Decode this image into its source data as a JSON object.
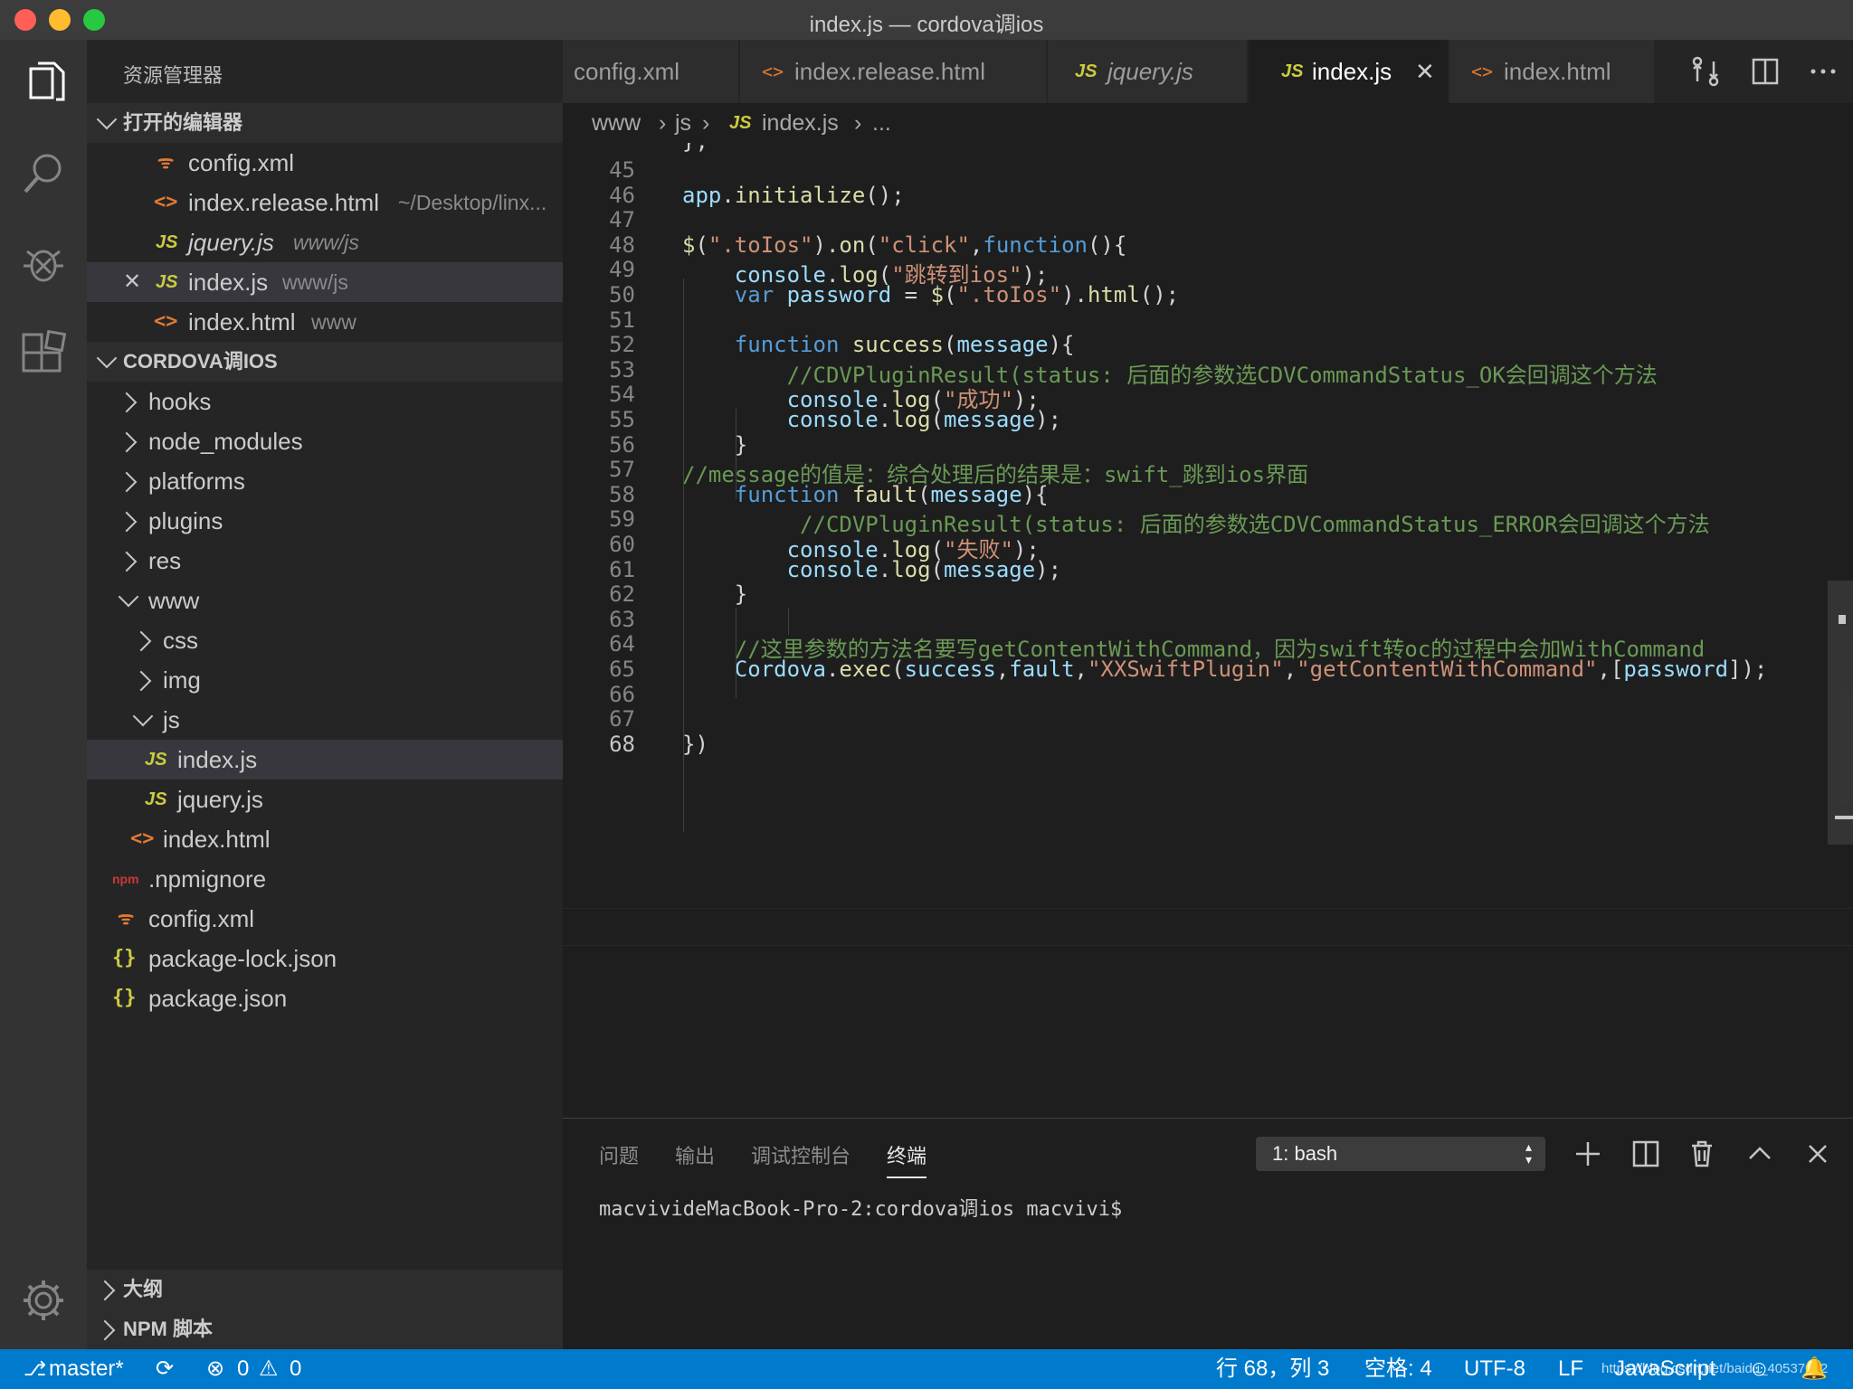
{
  "window": {
    "title": "index.js — cordova调ios"
  },
  "sidebar": {
    "header": "资源管理器",
    "open_editors": {
      "label": "打开的编辑器",
      "items": [
        {
          "name": "config.xml",
          "path": "",
          "icon": "xml-feed-icon"
        },
        {
          "name": "index.release.html",
          "path": "~/Desktop/linx...",
          "icon": "html-icon"
        },
        {
          "name": "jquery.js",
          "path": "www/js",
          "icon": "js-icon"
        },
        {
          "name": "index.js",
          "path": "www/js",
          "icon": "js-icon"
        },
        {
          "name": "index.html",
          "path": "www",
          "icon": "html-icon"
        }
      ]
    },
    "project": {
      "label": "CORDOVA调IOS",
      "items": [
        {
          "name": "hooks"
        },
        {
          "name": "node_modules"
        },
        {
          "name": "platforms"
        },
        {
          "name": "plugins"
        },
        {
          "name": "res"
        },
        {
          "name": "www"
        },
        {
          "name": "css"
        },
        {
          "name": "img"
        },
        {
          "name": "js"
        },
        {
          "name": "index.js"
        },
        {
          "name": "jquery.js"
        },
        {
          "name": "index.html"
        },
        {
          "name": ".npmignore"
        },
        {
          "name": "config.xml"
        },
        {
          "name": "package-lock.json"
        },
        {
          "name": "package.json"
        }
      ]
    },
    "outline_label": "大纲",
    "npm_label": "NPM 脚本"
  },
  "tabs": [
    {
      "label": "config.xml",
      "icon": ""
    },
    {
      "label": "index.release.html",
      "icon": "<>"
    },
    {
      "label": "jquery.js",
      "icon": "JS"
    },
    {
      "label": "index.js",
      "icon": "JS"
    },
    {
      "label": "index.html",
      "icon": "<>"
    }
  ],
  "tab_icon_glyphs": {
    "js": "JS",
    "html": "<>",
    "json": "{}",
    "npm": "npm",
    "close": "✕"
  },
  "breadcrumb": {
    "a": "www",
    "b": "js",
    "c": "index.js",
    "d": "..."
  },
  "editor": {
    "partial_top": "};",
    "lines": [
      {
        "n": "45",
        "code": ""
      },
      {
        "n": "46",
        "code": "app.initialize();"
      },
      {
        "n": "47",
        "code": ""
      },
      {
        "n": "48",
        "code": "$(\".toIos\").on(\"click\",function(){"
      },
      {
        "n": "49",
        "code": "    console.log(\"跳转到ios\");"
      },
      {
        "n": "50",
        "code": "    var password = $(\".toIos\").html();"
      },
      {
        "n": "51",
        "code": ""
      },
      {
        "n": "52",
        "code": "    function success(message){"
      },
      {
        "n": "53",
        "code": "        //CDVPluginResult(status: 后面的参数选CDVCommandStatus_OK会回调这个方法"
      },
      {
        "n": "54",
        "code": "        console.log(\"成功\");"
      },
      {
        "n": "55",
        "code": "        console.log(message);"
      },
      {
        "n": "56",
        "code": "    }"
      },
      {
        "n": "57",
        "code": "//message的值是：综合处理后的结果是：swift_跳到ios界面"
      },
      {
        "n": "58",
        "code": "    function fault(message){"
      },
      {
        "n": "59",
        "code": "         //CDVPluginResult(status: 后面的参数选CDVCommandStatus_ERROR会回调这个方法"
      },
      {
        "n": "60",
        "code": "        console.log(\"失败\");"
      },
      {
        "n": "61",
        "code": "        console.log(message);"
      },
      {
        "n": "62",
        "code": "    }"
      },
      {
        "n": "63",
        "code": ""
      },
      {
        "n": "64",
        "code": "    //这里参数的方法名要写getContentWithCommand，因为swift转oc的过程中会加WithCommand"
      },
      {
        "n": "65",
        "code": "    Cordova.exec(success,fault,\"XXSwiftPlugin\",\"getContentWithCommand\",[password]);"
      },
      {
        "n": "66",
        "code": ""
      },
      {
        "n": "67",
        "code": ""
      },
      {
        "n": "68",
        "code": "})"
      }
    ]
  },
  "panel": {
    "tabs": [
      "问题",
      "输出",
      "调试控制台",
      "终端"
    ],
    "terminal_select": "1: bash",
    "terminal_text": "macvivideMacBook-Pro-2:cordova调ios macvivi$"
  },
  "statusbar": {
    "branch": "master*",
    "errors": "0",
    "warnings": "0",
    "position": "行 68，列 3",
    "spaces": "空格: 4",
    "encoding": "UTF-8",
    "eol": "LF",
    "language": "JavaScript",
    "watermark": "https://blog.csdn.net/baidu_40537062"
  },
  "colors": {
    "accent": "#007acc",
    "sidebar_bg": "#252526",
    "editor_bg": "#1e1e1e"
  }
}
